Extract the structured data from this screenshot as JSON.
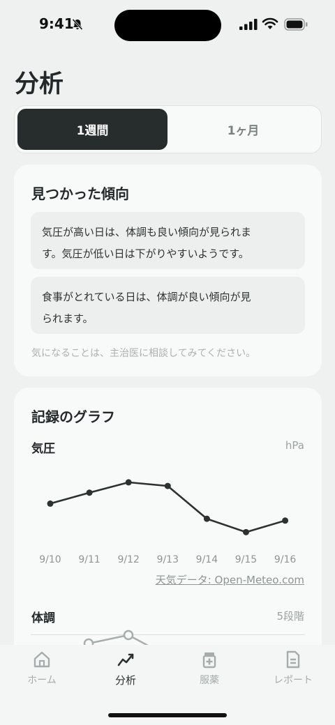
{
  "status": {
    "time": "9:41"
  },
  "page": {
    "title": "分析"
  },
  "segmented": {
    "week": "1週間",
    "month": "1ヶ月"
  },
  "trends": {
    "title": "見つかった傾向",
    "items": [
      {
        "line1": "気圧が高い日は、体調も良い傾向が見られま",
        "line2": "す。気圧が低い日は下がりやすいようです。"
      },
      {
        "line1": "食事がとれている日は、体調が良い傾向が見",
        "line2": "られます。"
      }
    ],
    "note": "気になることは、主治医に相談してみてください。"
  },
  "graphs": {
    "title": "記録のグラフ",
    "pressure": {
      "label": "気圧",
      "unit": "hPa"
    },
    "condition": {
      "label": "体調",
      "unit": "5段階"
    },
    "source": "天気データ: Open-Meteo.com"
  },
  "chart_data": {
    "type": "line",
    "categories": [
      "9/10",
      "9/11",
      "9/12",
      "9/13",
      "9/14",
      "9/15",
      "9/16"
    ],
    "series": [
      {
        "values": [
          1011.3,
          1013.1,
          1014.8,
          1014.2,
          1008.8,
          1006.6,
          1008.5
        ]
      }
    ],
    "ylim": [
      1004,
      1018
    ]
  },
  "tabs": [
    {
      "label": "ホーム",
      "icon": "home-icon"
    },
    {
      "label": "分析",
      "icon": "chart-icon"
    },
    {
      "label": "服薬",
      "icon": "medicine-icon"
    },
    {
      "label": "レポート",
      "icon": "report-icon"
    }
  ],
  "colors": {
    "accent": "#262d2c",
    "background": "#eef1f0",
    "card": "#f8faf9"
  }
}
